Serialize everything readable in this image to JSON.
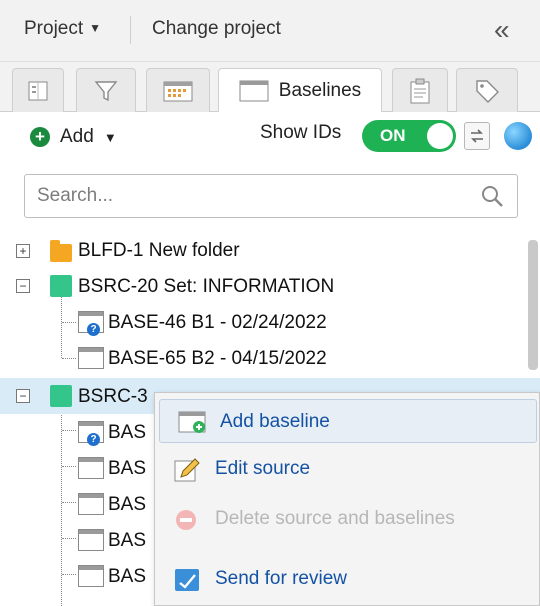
{
  "header": {
    "project_label": "Project",
    "change_project_label": "Change project",
    "collapse_glyph": "«"
  },
  "tabs": [
    {
      "icon": "list-icon",
      "label": ""
    },
    {
      "icon": "filter-icon",
      "label": ""
    },
    {
      "icon": "calendar-icon",
      "label": ""
    },
    {
      "icon": "window-icon",
      "label": "Baselines",
      "active": true
    },
    {
      "icon": "clipboard-icon",
      "label": ""
    },
    {
      "icon": "tag-icon",
      "label": ""
    }
  ],
  "toolbar": {
    "add_label": "Add",
    "show_ids_label": "Show IDs",
    "toggle_label": "ON",
    "toggle_color": "#1fb254"
  },
  "search": {
    "placeholder": "Search..."
  },
  "tree": {
    "rows": [
      {
        "label": "BLFD-1 New folder",
        "type": "folder",
        "expander": "+"
      },
      {
        "label": "BSRC-20 Set: INFORMATION",
        "type": "set",
        "expander": "−"
      },
      {
        "label": "BASE-46 B1 - 02/24/2022",
        "type": "baseline-pending"
      },
      {
        "label": "BASE-65 B2 - 04/15/2022",
        "type": "baseline"
      },
      {
        "label": "BSRC-3",
        "type": "set",
        "expander": "−",
        "selected": true
      },
      {
        "label": "BAS",
        "type": "baseline-pending"
      },
      {
        "label": "BAS",
        "type": "baseline"
      },
      {
        "label": "BAS",
        "type": "baseline"
      },
      {
        "label": "BAS",
        "type": "baseline"
      },
      {
        "label": "BAS",
        "type": "baseline"
      }
    ]
  },
  "context_menu": {
    "items": [
      {
        "label": "Add baseline",
        "icon": "add-baseline-icon",
        "hover": true
      },
      {
        "label": "Edit source",
        "icon": "pencil-icon"
      },
      {
        "label": "Delete source and baselines",
        "icon": "delete-icon",
        "disabled": true
      },
      {
        "label": "Send for review",
        "icon": "send-review-icon"
      }
    ]
  },
  "colors": {
    "accent_blue": "#1452a3",
    "selection": "#d8ebf7",
    "folder": "#f5a623",
    "set": "#33c58a"
  }
}
